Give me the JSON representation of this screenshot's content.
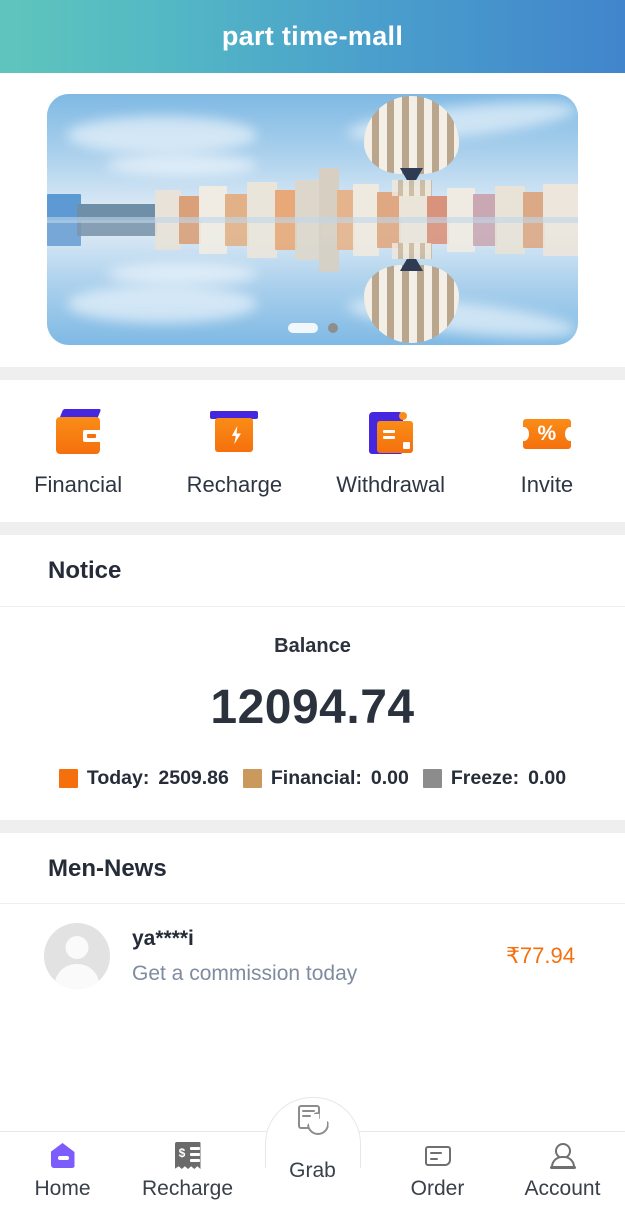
{
  "header": {
    "title": "part time-mall"
  },
  "banner": {
    "alt": "mirrored cityscape with hot air balloon",
    "dots": [
      {
        "index": 1,
        "active": true
      },
      {
        "index": 2,
        "active": false
      }
    ]
  },
  "quick_actions": [
    {
      "id": "financial",
      "label": "Financial",
      "icon": "wallet-icon"
    },
    {
      "id": "recharge",
      "label": "Recharge",
      "icon": "recharge-box-icon"
    },
    {
      "id": "withdrawal",
      "label": "Withdrawal",
      "icon": "withdraw-folder-icon"
    },
    {
      "id": "invite",
      "label": "Invite",
      "icon": "percent-ticket-icon"
    }
  ],
  "notice": {
    "title": "Notice"
  },
  "balance": {
    "label": "Balance",
    "amount": "12094.74",
    "stats": [
      {
        "label": "Today:",
        "value": "2509.86",
        "color": "#f5700d"
      },
      {
        "label": "Financial:",
        "value": "0.00",
        "color": "#c99a5b"
      },
      {
        "label": "Freeze:",
        "value": "0.00",
        "color": "#8c8c8c"
      }
    ]
  },
  "news": {
    "title": "Men-News",
    "items": [
      {
        "user": "ya****i",
        "message": "Get a commission today",
        "amount": "₹77.94"
      }
    ]
  },
  "tabbar": {
    "items": [
      {
        "id": "home",
        "label": "Home",
        "icon": "home-icon",
        "active": true
      },
      {
        "id": "recharge",
        "label": "Recharge",
        "icon": "receipt-icon",
        "active": false
      },
      {
        "id": "grab",
        "label": "Grab",
        "icon": "tap-hand-icon",
        "active": false
      },
      {
        "id": "order",
        "label": "Order",
        "icon": "document-icon",
        "active": false
      },
      {
        "id": "account",
        "label": "Account",
        "icon": "user-icon",
        "active": false
      }
    ]
  },
  "colors": {
    "header_gradient_start": "#5fc5bc",
    "header_gradient_end": "#4185cc",
    "accent_orange": "#f5700d",
    "accent_purple": "#4527e0",
    "tab_active": "#7c5cfa",
    "separator": "#efefef"
  }
}
